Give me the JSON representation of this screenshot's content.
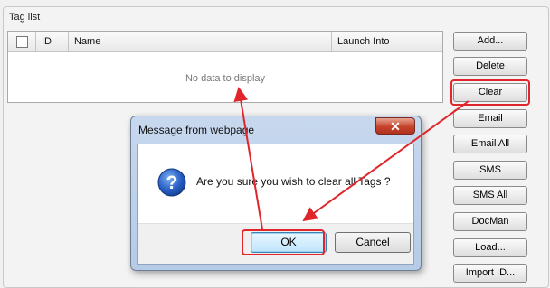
{
  "group": {
    "title": "Tag list"
  },
  "grid": {
    "columns": [
      "ID",
      "Name",
      "Launch Into"
    ],
    "empty_message": "No data to display"
  },
  "buttons": [
    "Add...",
    "Delete",
    "Clear",
    "Email",
    "Email All",
    "SMS",
    "SMS All",
    "DocMan",
    "Load...",
    "Import ID..."
  ],
  "dialog": {
    "title": "Message from webpage",
    "close_glyph": "✕",
    "message": "Are you sure you wish to clear all Tags ?",
    "ok_label": "OK",
    "cancel_label": "Cancel",
    "icon": "question-icon"
  },
  "colors": {
    "highlight": "#e0262a"
  }
}
